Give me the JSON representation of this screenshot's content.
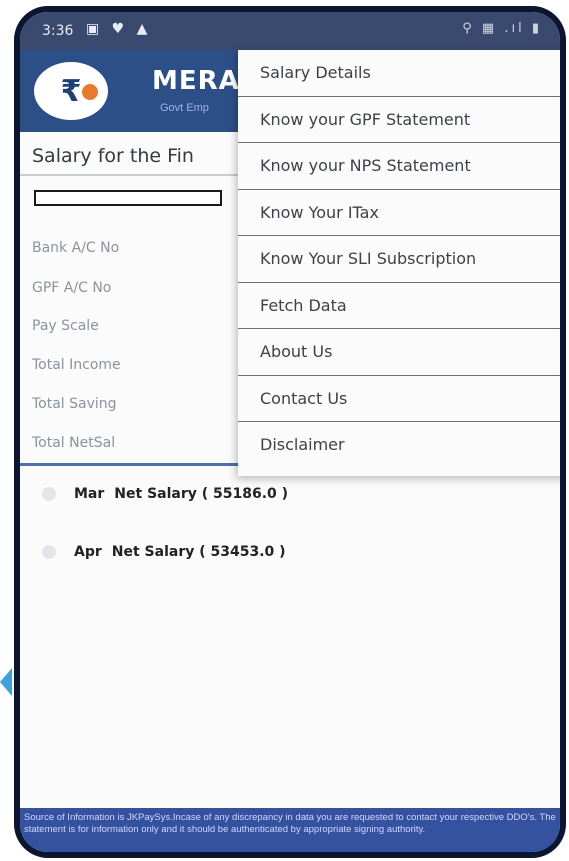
{
  "status_bar": {
    "time": "3:36",
    "left_icons": "▣ ♥ ▲",
    "right_icons": "⚲ ▦ .ıl ▮"
  },
  "header": {
    "logo_symbol": "₹",
    "title": "MERA",
    "subtitle": "Govt Emp"
  },
  "page": {
    "section_title": "Salary for the Fin",
    "fields": [
      {
        "label": "Bank A/C No"
      },
      {
        "label": "GPF A/C No"
      },
      {
        "label": "Pay Scale"
      },
      {
        "label": "Total Income"
      },
      {
        "label": "Total Saving"
      },
      {
        "label": "Total NetSal"
      }
    ],
    "months": [
      {
        "month": "Mar",
        "text": "Net Salary ( 55186.0 )"
      },
      {
        "month": "Apr",
        "text": "Net Salary ( 53453.0 )"
      }
    ]
  },
  "menu": {
    "items": [
      "Salary Details",
      "Know your GPF Statement",
      "Know your NPS Statement",
      "Know Your ITax",
      "Know Your SLI Subscription",
      "Fetch Data",
      "About Us",
      "Contact Us",
      "Disclaimer"
    ]
  },
  "footer": {
    "text": "Source of Information is JKPaySys.Incase of any discrepancy in data you are requested to contact your respective DDO's. The statement is for information only and it should be authenticated by appropriate signing authority."
  },
  "colors": {
    "header_bg": "#2d4f88",
    "status_bg": "#3a4a6e",
    "accent_rule": "#4d6fae",
    "footer_bg": "#3452a0"
  }
}
